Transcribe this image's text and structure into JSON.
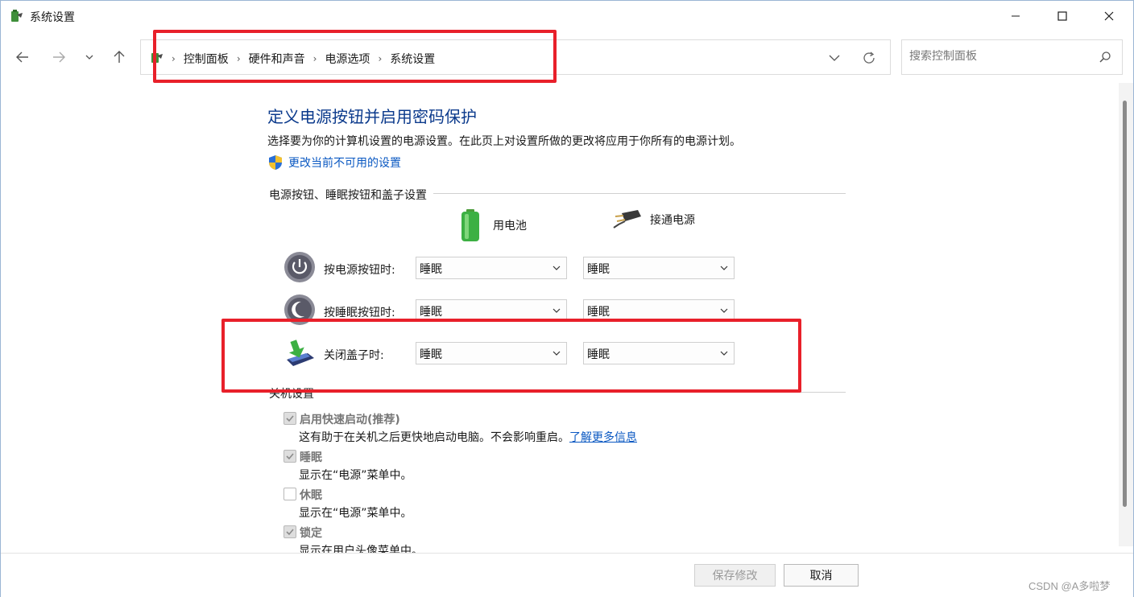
{
  "window": {
    "title": "系统设置"
  },
  "nav": {
    "breadcrumbs": [
      "控制面板",
      "硬件和声音",
      "电源选项",
      "系统设置"
    ],
    "search_placeholder": "搜索控制面板"
  },
  "page": {
    "heading": "定义电源按钮并启用密码保护",
    "description": "选择要为你的计算机设置的电源设置。在此页上对设置所做的更改将应用于你所有的电源计划。",
    "change_link": "更改当前不可用的设置"
  },
  "buttons_section": {
    "title": "电源按钮、睡眠按钮和盖子设置",
    "battery_label": "用电池",
    "plugged_label": "接通电源",
    "rows": [
      {
        "label": "按电源按钮时:",
        "battery": "睡眠",
        "plugged": "睡眠"
      },
      {
        "label": "按睡眠按钮时:",
        "battery": "睡眠",
        "plugged": "睡眠"
      },
      {
        "label": "关闭盖子时:",
        "battery": "睡眠",
        "plugged": "睡眠"
      }
    ]
  },
  "shutdown_section": {
    "title": "关机设置",
    "items": [
      {
        "title": "启用快速启动(推荐)",
        "checked": true,
        "desc": "这有助于在关机之后更快地启动电脑。不会影响重启。",
        "link": "了解更多信息"
      },
      {
        "title": "睡眠",
        "checked": true,
        "desc": "显示在“电源”菜单中。"
      },
      {
        "title": "休眠",
        "checked": false,
        "desc": "显示在“电源”菜单中。"
      },
      {
        "title": "锁定",
        "checked": true,
        "desc": "显示在用户头像菜单中。"
      }
    ]
  },
  "footer": {
    "save_label": "保存修改",
    "cancel_label": "取消",
    "watermark": "CSDN @A多啦梦"
  },
  "colors": {
    "heading": "#0b3a8c",
    "link": "#0a58c2",
    "annotation": "#e8202a"
  }
}
